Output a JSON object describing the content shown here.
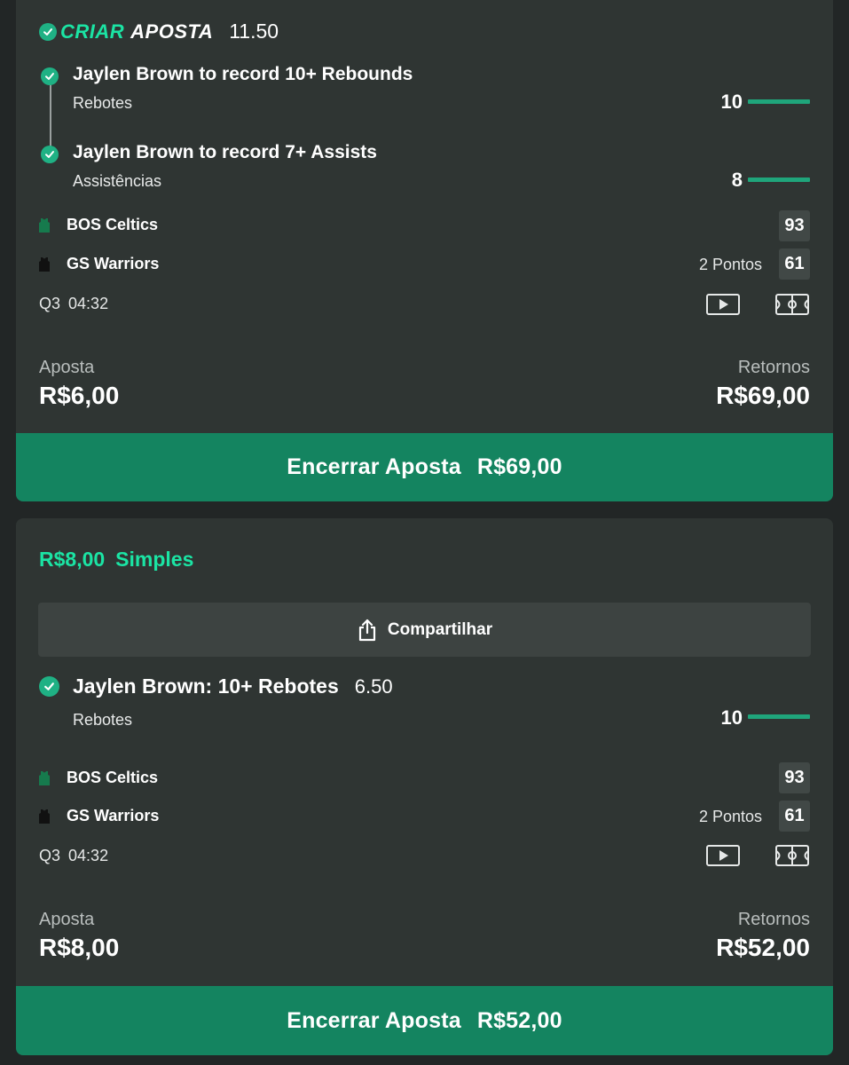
{
  "bets": [
    {
      "header": {
        "logo_part1": "CRIAR",
        "logo_part2": "APOSTA",
        "odds": "11.50"
      },
      "selections": [
        {
          "title": "Jaylen Brown to record 10+ Rebounds",
          "stat_label": "Rebotes",
          "value": "10"
        },
        {
          "title": "Jaylen Brown to record 7+ Assists",
          "stat_label": "Assistências",
          "value": "8"
        }
      ],
      "teams": [
        {
          "name": "BOS Celtics",
          "score": "93",
          "jersey_color": "#167a4d"
        },
        {
          "name": "GS Warriors",
          "note": "2 Pontos",
          "score": "61",
          "jersey_color": "#111111"
        }
      ],
      "clock": {
        "period": "Q3",
        "time": "04:32"
      },
      "stake_label": "Aposta",
      "stake": "R$6,00",
      "returns_label": "Retornos",
      "returns": "R$69,00",
      "cashout_label": "Encerrar Aposta",
      "cashout_amount": "R$69,00"
    },
    {
      "header": {
        "amount": "R$8,00",
        "type": "Simples"
      },
      "share_label": "Compartilhar",
      "selection": {
        "title": "Jaylen Brown: 10+ Rebotes",
        "odds": "6.50",
        "stat_label": "Rebotes",
        "value": "10"
      },
      "teams": [
        {
          "name": "BOS Celtics",
          "score": "93",
          "jersey_color": "#167a4d"
        },
        {
          "name": "GS Warriors",
          "note": "2 Pontos",
          "score": "61",
          "jersey_color": "#111111"
        }
      ],
      "clock": {
        "period": "Q3",
        "time": "04:32"
      },
      "stake_label": "Aposta",
      "stake": "R$8,00",
      "returns_label": "Retornos",
      "returns": "R$52,00",
      "cashout_label": "Encerrar Aposta",
      "cashout_amount": "R$52,00"
    }
  ],
  "colors": {
    "accent": "#1be4a4",
    "cashout": "#148460",
    "card": "#2f3533",
    "background": "#222626"
  },
  "icons": [
    "check-icon",
    "jersey-icon",
    "play-video-icon",
    "court-icon",
    "share-icon"
  ]
}
